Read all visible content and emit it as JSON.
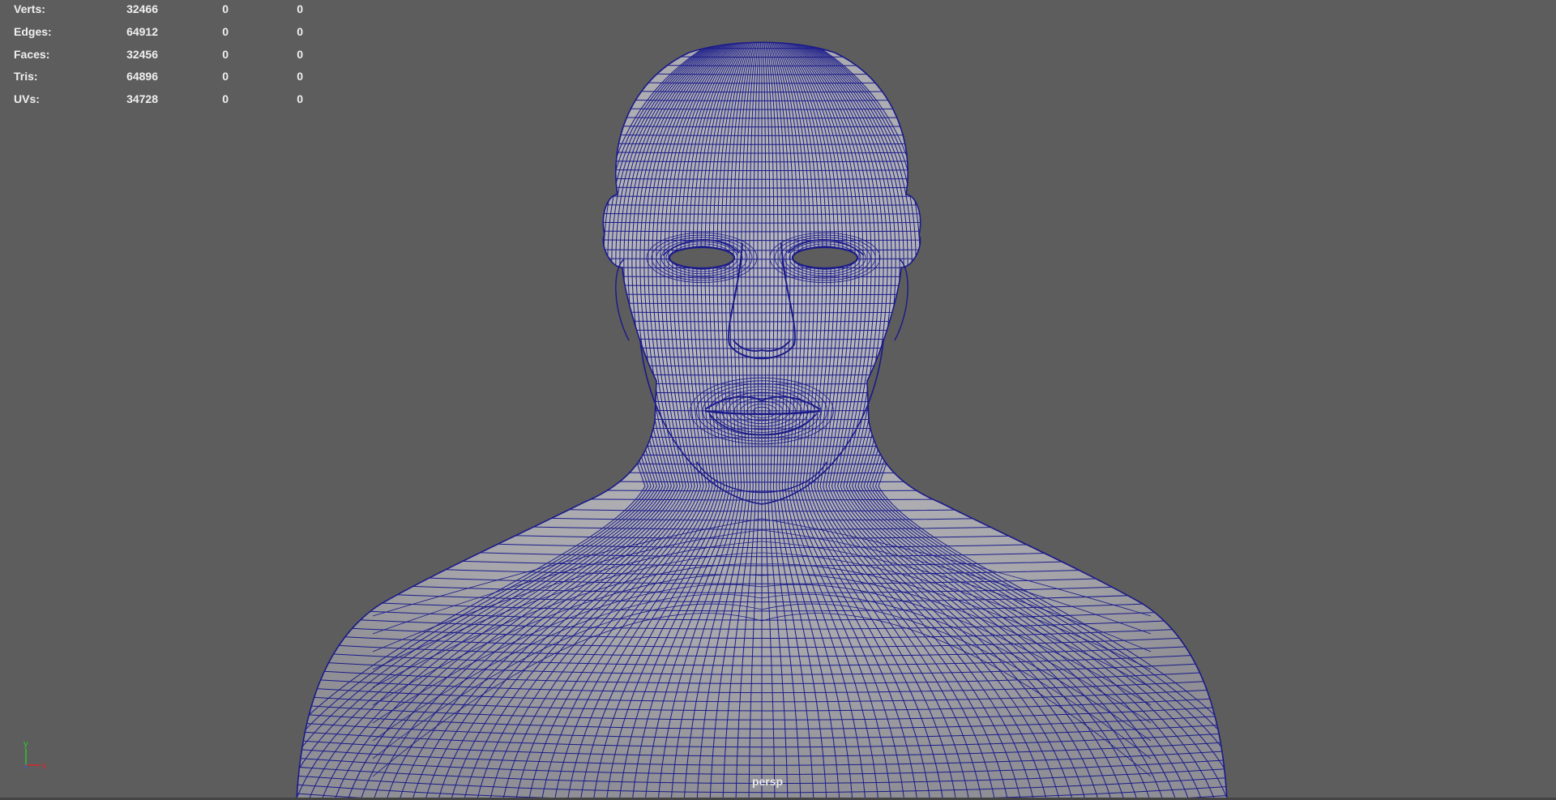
{
  "hud": {
    "rows": [
      {
        "label": "Verts:",
        "total": "32466",
        "selected": "0",
        "component": "0"
      },
      {
        "label": "Edges:",
        "total": "64912",
        "selected": "0",
        "component": "0"
      },
      {
        "label": "Faces:",
        "total": "32456",
        "selected": "0",
        "component": "0"
      },
      {
        "label": "Tris:",
        "total": "64896",
        "selected": "0",
        "component": "0"
      },
      {
        "label": "UVs:",
        "total": "34728",
        "selected": "0",
        "component": "0"
      }
    ]
  },
  "camera": {
    "name": "persp"
  },
  "axis": {
    "y_label": "y",
    "x_label": "x"
  },
  "colors": {
    "background": "#5d5d5d",
    "mesh_fill": "#a7a7ab",
    "wire": "#1a1a8a",
    "axis_y": "#2ec42e",
    "axis_x": "#d02a2a"
  },
  "icons": {
    "axis": "axis-gizmo-icon"
  }
}
